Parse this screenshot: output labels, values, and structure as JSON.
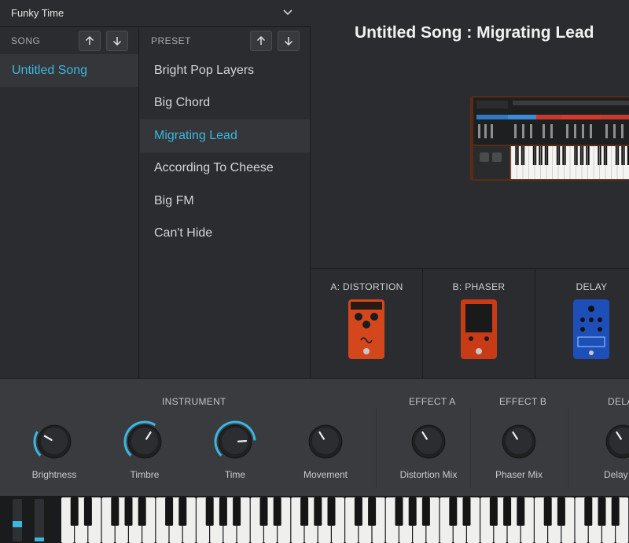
{
  "setlist": {
    "name": "Funky Time"
  },
  "song": {
    "header": "SONG",
    "items": [
      "Untitled Song"
    ]
  },
  "preset": {
    "header": "PRESET",
    "items": [
      "Bright Pop Layers",
      "Big Chord",
      "Migrating Lead",
      "According To Cheese",
      "Big FM",
      "Can't Hide"
    ],
    "selected": "Migrating Lead"
  },
  "main": {
    "title": "Untitled Song : Migrating Lead"
  },
  "effects": [
    {
      "label": "A: DISTORTION",
      "color": "#d4471c"
    },
    {
      "label": "B: PHASER",
      "color": "#c93a17"
    },
    {
      "label": "DELAY",
      "color": "#1e4fb8"
    }
  ],
  "controls": {
    "sections": [
      "INSTRUMENT",
      "EFFECT A",
      "EFFECT B",
      "DELA"
    ],
    "knobs": [
      {
        "label": "Brightness",
        "value": 0.28
      },
      {
        "label": "Timbre",
        "value": 0.62
      },
      {
        "label": "Time",
        "value": 0.82
      },
      {
        "label": "Movement",
        "value": 0.38
      },
      {
        "label": "Distortion Mix",
        "value": 0.38
      },
      {
        "label": "Phaser Mix",
        "value": 0.38
      },
      {
        "label": "Delay Vo",
        "value": 0.38
      }
    ]
  },
  "colors": {
    "accent": "#3bb6e0",
    "background": "#2b2c2f"
  }
}
